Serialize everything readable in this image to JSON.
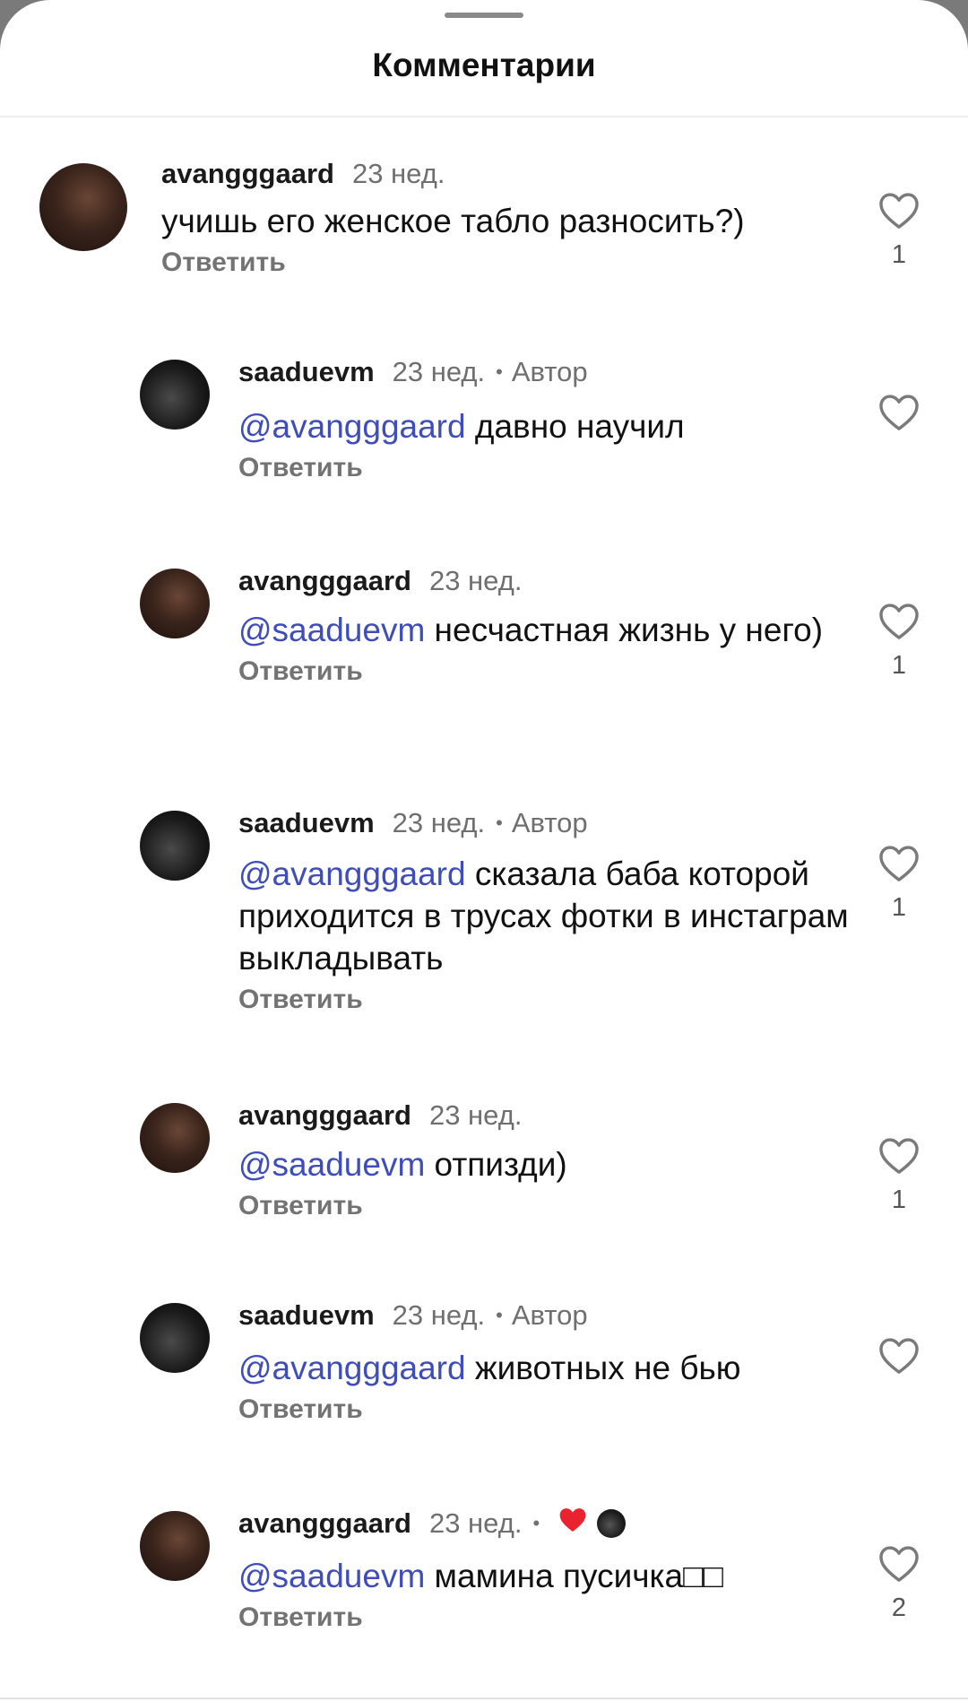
{
  "sheet": {
    "title": "Комментарии"
  },
  "comments": [
    {
      "username": "avangggaard",
      "time": "23 нед.",
      "mention": "",
      "text": "учишь его женское табло разносить?)",
      "reply": "Ответить",
      "likes": "1",
      "avatar_icon": "user-avatar-icon"
    },
    {
      "username": "saaduevm",
      "time": "23 нед.",
      "author": "Автор",
      "mention": "@avangggaard",
      "text": " давно научил",
      "reply": "Ответить",
      "likes": "",
      "avatar_icon": "user-avatar-icon"
    },
    {
      "username": "avangggaard",
      "time": "23 нед.",
      "mention": "@saaduevm",
      "text": " несчастная жизнь у него)",
      "reply": "Ответить",
      "likes": "1",
      "avatar_icon": "user-avatar-icon"
    },
    {
      "username": "saaduevm",
      "time": "23 нед.",
      "author": "Автор",
      "mention": "@avangggaard",
      "text": " сказала баба которой приходится в трусах фотки в инстаграм выкладывать",
      "reply": "Ответить",
      "likes": "1",
      "avatar_icon": "user-avatar-icon"
    },
    {
      "username": "avangggaard",
      "time": "23 нед.",
      "mention": "@saaduevm",
      "text": " отпизди)",
      "reply": "Ответить",
      "likes": "1",
      "avatar_icon": "user-avatar-icon"
    },
    {
      "username": "saaduevm",
      "time": "23 нед.",
      "author": "Автор",
      "mention": "@avangggaard",
      "text": " животных не бью",
      "reply": "Ответить",
      "likes": "",
      "avatar_icon": "user-avatar-icon"
    },
    {
      "username": "avangggaard",
      "time": "23 нед.",
      "mention": "@saaduevm",
      "text": " мамина пусичка□□",
      "reply": "Ответить",
      "likes": "2",
      "avatar_icon": "user-avatar-icon",
      "liked_by_author": true
    }
  ],
  "colors": {
    "mention": "#3f4db8",
    "author_like_heart": "#e8222e"
  },
  "icons": {
    "like": "heart-outline-icon",
    "author_liked": "heart-filled-icon"
  }
}
